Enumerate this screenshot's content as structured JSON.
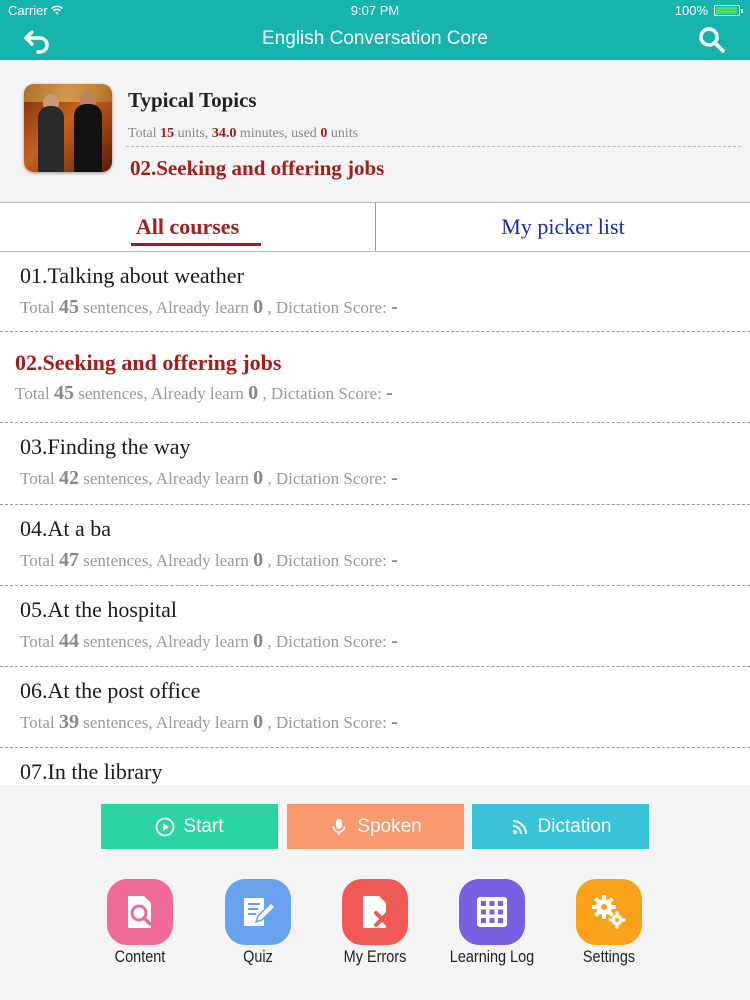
{
  "status_bar": {
    "carrier": "Carrier",
    "time": "9:07 PM",
    "battery": "100%"
  },
  "nav": {
    "title": "English Conversation Core",
    "back_icon": "back-arrow-icon",
    "search_icon": "search-icon"
  },
  "header": {
    "title": "Typical Topics",
    "stats": {
      "prefix": "Total ",
      "units": "15",
      "mid1": " units, ",
      "minutes": "34.0",
      "mid2": " minutes, used ",
      "used": "0",
      "suffix": " units"
    },
    "current_course": "02.Seeking and offering jobs"
  },
  "tabs": [
    {
      "label": "All courses",
      "active": true
    },
    {
      "label": "My picker list",
      "active": false
    }
  ],
  "list_labels": {
    "total": "Total ",
    "sentences": " sentences, Already learn ",
    "dictation": " , Dictation Score: "
  },
  "courses": [
    {
      "name": "01.Talking about weather",
      "total": "45",
      "learned": "0",
      "score": "-",
      "current": false
    },
    {
      "name": "02.Seeking and offering jobs",
      "total": "45",
      "learned": "0",
      "score": "-",
      "current": true
    },
    {
      "name": "03.Finding the way",
      "total": "42",
      "learned": "0",
      "score": "-",
      "current": false
    },
    {
      "name": "04.At a ba",
      "total": "47",
      "learned": "0",
      "score": "-",
      "current": false
    },
    {
      "name": "05.At the hospital",
      "total": "44",
      "learned": "0",
      "score": "-",
      "current": false
    },
    {
      "name": "06.At the post office",
      "total": "39",
      "learned": "0",
      "score": "-",
      "current": false
    },
    {
      "name": "07.In the library",
      "total": "",
      "learned": "",
      "score": "",
      "current": false
    }
  ],
  "actions": {
    "start": "Start",
    "spoken": "Spoken",
    "dictation": "Dictation"
  },
  "tools": {
    "content": "Content",
    "quiz": "Quiz",
    "errors": "My Errors",
    "log": "Learning Log",
    "settings": "Settings"
  },
  "colors": {
    "teal": "#17b3ad",
    "accent_red": "#a51d1d",
    "link_blue": "#1a2bb5",
    "start": "#2cd3a3",
    "spoken": "#f89970",
    "dictation": "#3cc2d8"
  }
}
